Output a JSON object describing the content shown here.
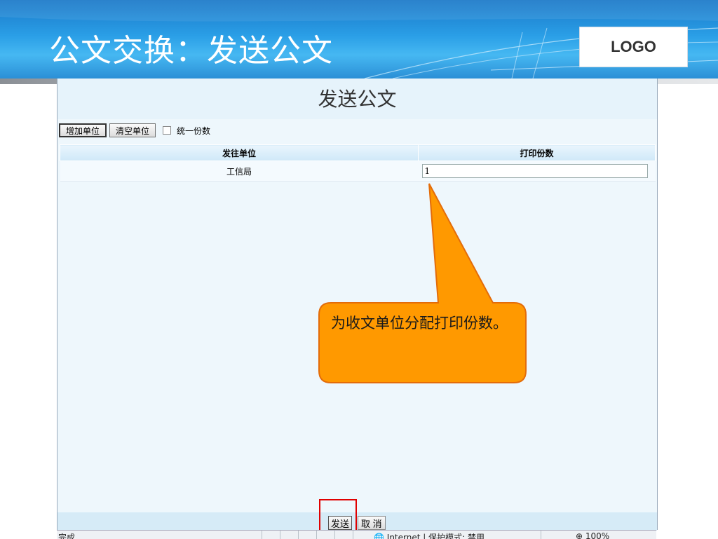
{
  "slide": {
    "title": "公文交换：发送公文",
    "logo": "LOGO"
  },
  "page": {
    "heading": "发送公文"
  },
  "toolbar": {
    "add_unit_label": "增加单位",
    "clear_unit_label": "清空单位",
    "unify_copies_label": "统一份数",
    "unify_copies_checked": false
  },
  "table": {
    "headers": [
      "发往单位",
      "打印份数"
    ],
    "rows": [
      {
        "unit": "工信局",
        "copies": "1"
      }
    ]
  },
  "callout": {
    "text": "为收文单位分配打印份数。",
    "fill_color": "#ff9900",
    "border_color": "#e36c0a"
  },
  "actions": {
    "send_label": "发送",
    "cancel_label": "取 消",
    "highlight_color": "#e00000"
  },
  "statusbar": {
    "left": "完成",
    "zone": "Internet | 保护模式: 禁用",
    "zoom": "100%"
  }
}
